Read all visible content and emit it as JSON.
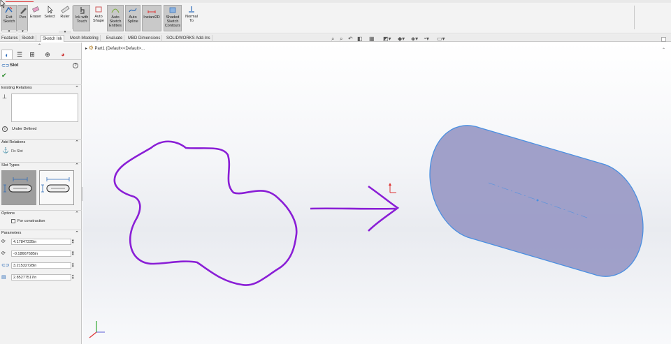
{
  "ribbon": {
    "buttons": [
      {
        "id": "exit-sketch",
        "label": "Exit Sketch",
        "icon": "exit-sketch-icon"
      },
      {
        "id": "pen",
        "label": "Pen",
        "icon": "pen-icon"
      },
      {
        "id": "eraser",
        "label": "Eraser",
        "icon": "eraser-icon"
      },
      {
        "id": "select",
        "label": "Select",
        "icon": "select-arrow-icon"
      },
      {
        "id": "ruler",
        "label": "Ruler",
        "icon": "ruler-icon"
      },
      {
        "id": "ink-with-touch",
        "label": "Ink with Touch",
        "icon": "touch-hand-icon"
      },
      {
        "id": "auto-shape",
        "label": "Auto Shape",
        "icon": "auto-shape-icon"
      },
      {
        "id": "auto-sketch-entities",
        "label": "Auto Sketch Entities",
        "icon": "sketch-entities-icon"
      },
      {
        "id": "auto-spline",
        "label": "Auto Spline",
        "icon": "spline-icon"
      },
      {
        "id": "instant2d",
        "label": "Instant2D",
        "icon": "instant2d-icon"
      },
      {
        "id": "shaded-sketch-contours",
        "label": "Shaded Sketch Contours",
        "icon": "shaded-contours-icon"
      },
      {
        "id": "normal-to",
        "label": "Normal To",
        "icon": "normal-to-icon"
      }
    ]
  },
  "tabs": [
    "Features",
    "Sketch",
    "Sketch Ink",
    "Mesh Modeling",
    "Evaluate",
    "MBD Dimensions",
    "SOLIDWORKS Add-Ins"
  ],
  "active_tab": "Sketch Ink",
  "panel": {
    "title": "Slot",
    "existing_relations": "Existing Relations",
    "status": "Under Defined",
    "add_relations": "Add Relations",
    "fix_label": "Fix Slot",
    "slot_types": "Slot Types",
    "options": "Options",
    "for_construction": "For construction",
    "parameters": "Parameters",
    "params": [
      {
        "icon": "center-x-icon",
        "value": "4.17847335in"
      },
      {
        "icon": "center-y-icon",
        "value": "-0.18667685in"
      },
      {
        "icon": "slot-width-icon",
        "value": "3.21532728in"
      },
      {
        "icon": "slot-length-icon",
        "value": "2.85277517in"
      }
    ]
  },
  "tree": {
    "part": "Part1 (Default<<Default>..."
  },
  "colors": {
    "ink": "#8a1ed6",
    "slot_fill": "#9b9bc6",
    "slot_edge": "#4a90e2",
    "ribbon_active": "#c9c9c9"
  }
}
